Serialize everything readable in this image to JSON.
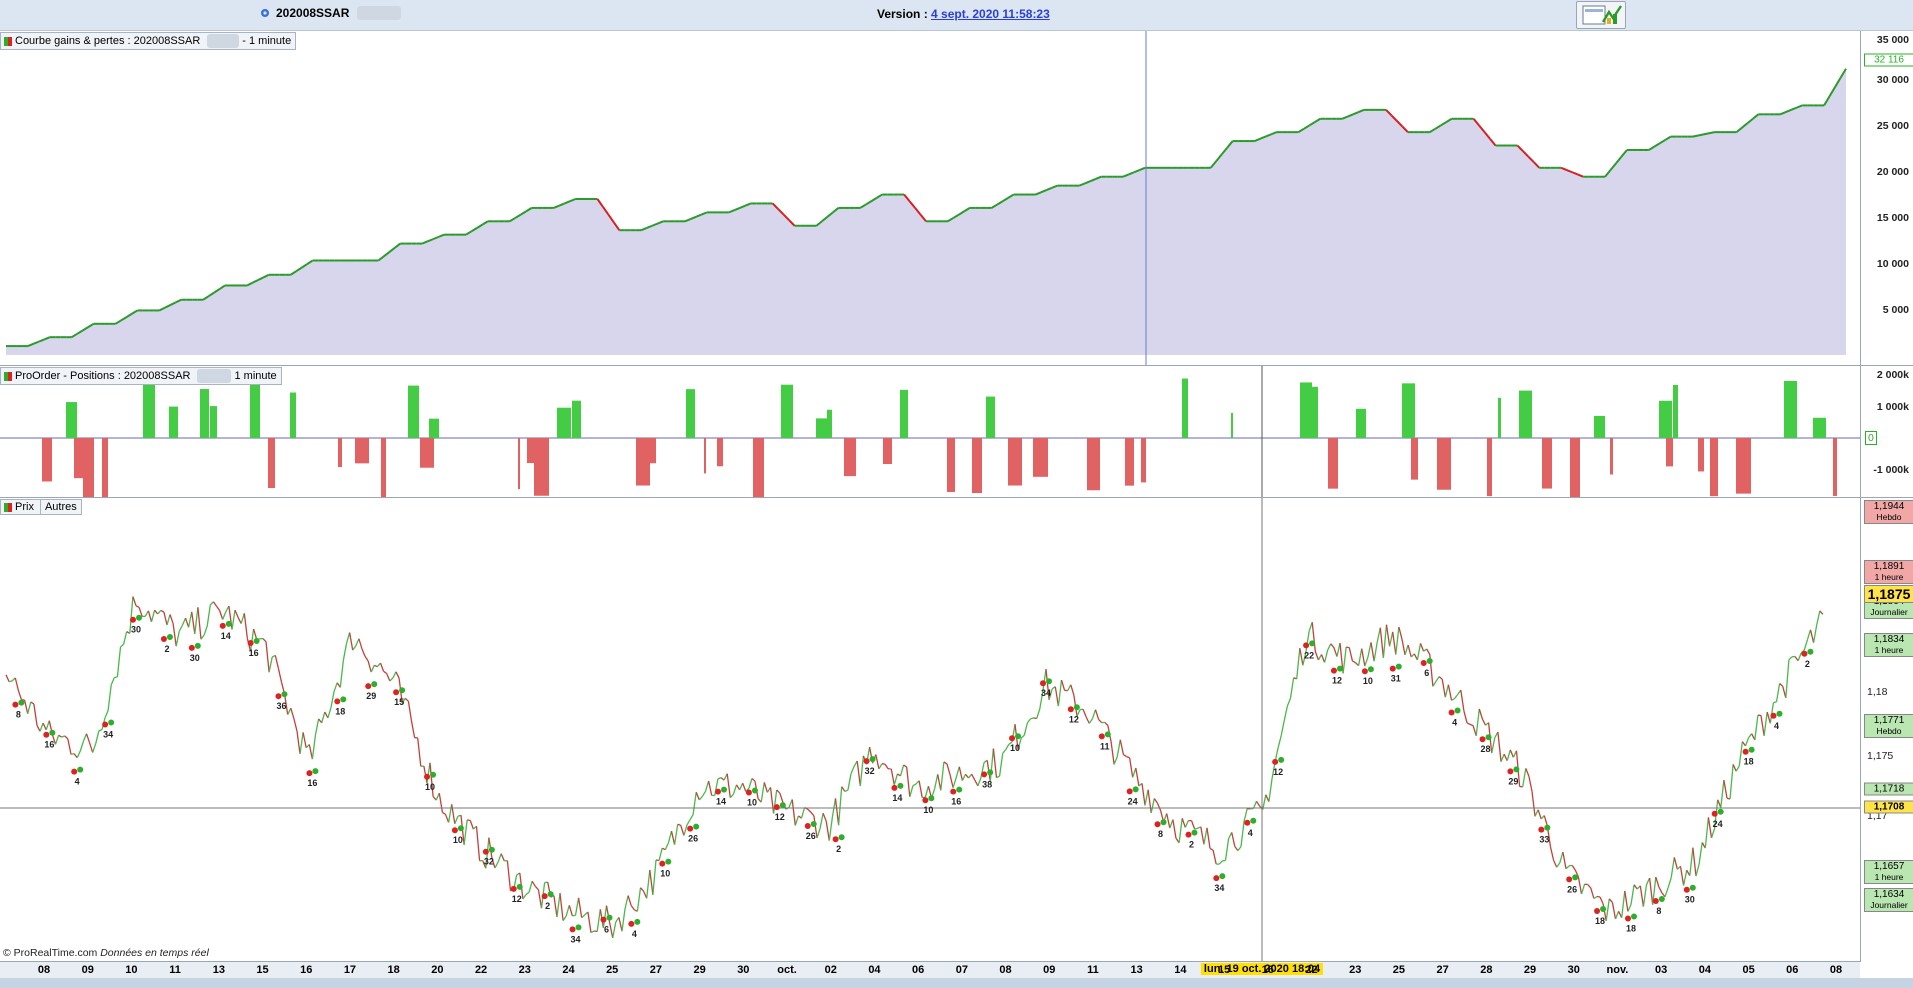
{
  "header": {
    "strategy_name": "202008SSAR",
    "version_label": "Version :",
    "version_link": "4 sept. 2020 11:58:23"
  },
  "panels": {
    "equity": {
      "title": "Courbe gains & pertes : 202008SSAR",
      "suffix": "- 1 minute",
      "yticks": [
        "35 000",
        "30 000",
        "25 000",
        "20 000",
        "15 000",
        "10 000",
        "5 000"
      ],
      "last_value": "32 116"
    },
    "positions": {
      "title": "ProOrder - Positions : 202008SSAR",
      "suffix": "1 minute",
      "yticks": [
        "2 000k",
        "1 000k",
        "0",
        "-1 000k"
      ]
    },
    "price": {
      "tab_price": "Prix",
      "tab_other": "Autres",
      "yticks": [
        "1,18",
        "1,175",
        "1,17"
      ],
      "tags": {
        "t1944": {
          "value": "1,1944",
          "sub": "Hebdo"
        },
        "t1891": {
          "value": "1,1891",
          "sub": "1 heure"
        },
        "t1875": {
          "value": "1,1875"
        },
        "t1864": {
          "value": "1,1864",
          "sub": "Journalier"
        },
        "t1834": {
          "value": "1,1834",
          "sub": "1 heure"
        },
        "t1771": {
          "value": "1,1771",
          "sub": "Hebdo"
        },
        "t1718": {
          "value": "1,1718"
        },
        "t1708": {
          "value": "1,1708"
        },
        "t1657": {
          "value": "1,1657",
          "sub": "1 heure"
        },
        "t1634": {
          "value": "1,1634",
          "sub": "Journalier"
        }
      },
      "trade_counts": [
        "8",
        "16",
        "4",
        "34",
        "30",
        "2",
        "30",
        "14",
        "16",
        "36",
        "16",
        "18",
        "29",
        "15",
        "10",
        "10",
        "32",
        "12",
        "2",
        "34",
        "6",
        "4",
        "10",
        "26",
        "14",
        "10",
        "12",
        "26",
        "2",
        "32",
        "14",
        "10",
        "16",
        "38",
        "10",
        "34",
        "12",
        "11",
        "24",
        "8",
        "2",
        "34",
        "4",
        "12",
        "22",
        "12",
        "10",
        "31",
        "6",
        "4",
        "28",
        "29",
        "33",
        "26",
        "18",
        "18",
        "8",
        "30",
        "24",
        "18",
        "4",
        "2"
      ]
    }
  },
  "x_axis": {
    "labels": [
      "08",
      "09",
      "10",
      "11",
      "13",
      "15",
      "16",
      "17",
      "18",
      "20",
      "22",
      "23",
      "24",
      "25",
      "27",
      "29",
      "30",
      "oct.",
      "02",
      "04",
      "06",
      "07",
      "08",
      "09",
      "11",
      "13",
      "14",
      "15",
      "16",
      "22",
      "23",
      "25",
      "27",
      "28",
      "29",
      "30",
      "nov.",
      "03",
      "04",
      "05",
      "06",
      "08"
    ],
    "cursor_label": "lun. 19 oct. 2020 18:04"
  },
  "footer": {
    "credit": "© ProRealTime.com",
    "credit_note": "Données en temps réel"
  },
  "chart_data": [
    {
      "type": "area",
      "title": "Courbe gains & pertes : 202008SSAR - 1 minute",
      "ylim": [
        0,
        35000
      ],
      "grid": false,
      "x": [
        "08",
        "09",
        "10",
        "11",
        "13",
        "15",
        "16",
        "17",
        "18",
        "20",
        "22",
        "23",
        "24",
        "25",
        "27",
        "29",
        "30",
        "oct.",
        "02",
        "04",
        "06",
        "07",
        "08",
        "09",
        "11",
        "13",
        "14",
        "15",
        "16",
        "19",
        "22",
        "23",
        "25",
        "27",
        "28",
        "29",
        "30",
        "nov.",
        "03",
        "04",
        "05",
        "06",
        "08"
      ],
      "values": [
        1000,
        2000,
        3500,
        5000,
        6200,
        7800,
        9000,
        10600,
        10600,
        12500,
        13500,
        15000,
        16500,
        17500,
        14000,
        15000,
        16000,
        17000,
        14500,
        16500,
        18000,
        15000,
        16500,
        18000,
        19000,
        20000,
        21000,
        21000,
        24000,
        25000,
        26500,
        27500,
        25000,
        26500,
        23500,
        21000,
        20000,
        23000,
        24500,
        25000,
        27000,
        28000,
        32116
      ],
      "colors": {
        "fill": "#d7d6ec",
        "up": "#2a9a2a",
        "down": "#d42020"
      }
    },
    {
      "type": "bar",
      "title": "ProOrder - Positions : 202008SSAR 1 minute",
      "ylim": [
        -1500,
        2000
      ],
      "unit": "k",
      "colors": {
        "long": "#44cc44",
        "short": "#e06262"
      }
    },
    {
      "type": "line",
      "title": "Prix",
      "ylim": [
        1.161,
        1.1955
      ],
      "x": [
        "08",
        "09",
        "10",
        "11",
        "13",
        "15",
        "16",
        "17",
        "18",
        "20",
        "22",
        "23",
        "24",
        "25",
        "27",
        "29",
        "30",
        "oct.",
        "02",
        "04",
        "06",
        "07",
        "08",
        "09",
        "11",
        "13",
        "14",
        "15",
        "16",
        "19",
        "22",
        "23",
        "25",
        "27",
        "28",
        "29",
        "30",
        "nov.",
        "03",
        "04",
        "05",
        "06",
        "08"
      ],
      "values": [
        1.183,
        1.178,
        1.177,
        1.189,
        1.186,
        1.188,
        1.185,
        1.176,
        1.186,
        1.182,
        1.173,
        1.169,
        1.166,
        1.164,
        1.163,
        1.167,
        1.174,
        1.174,
        1.172,
        1.171,
        1.177,
        1.174,
        1.175,
        1.176,
        1.182,
        1.18,
        1.175,
        1.171,
        1.169,
        1.172,
        1.186,
        1.184,
        1.186,
        1.183,
        1.179,
        1.175,
        1.167,
        1.164,
        1.166,
        1.168,
        1.176,
        1.182,
        1.1875
      ],
      "colors": {
        "line": "#4ab84a",
        "down": "#c0413a"
      }
    }
  ]
}
